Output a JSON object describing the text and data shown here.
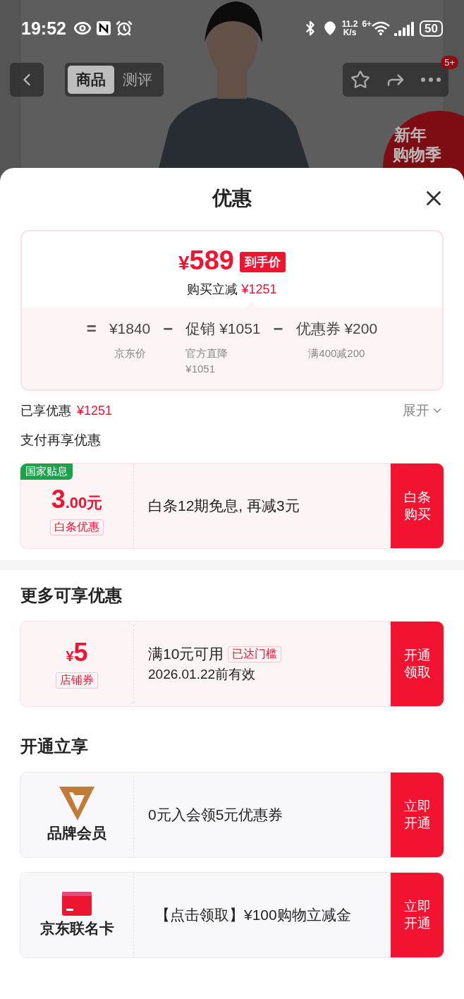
{
  "status_bar": {
    "time": "19:52",
    "speed_value": "11.2",
    "speed_unit": "K/s",
    "network": "6+",
    "battery": "50"
  },
  "nav": {
    "tabs": [
      {
        "label": "商品",
        "selected": true
      },
      {
        "label": "测评",
        "selected": false
      }
    ],
    "more_badge": "5+"
  },
  "promo_badge": [
    "新年",
    "购物季"
  ],
  "sheet": {
    "title": "优惠"
  },
  "price": {
    "currency": "¥",
    "amount": "589",
    "tag": "到手价",
    "saving_label": "购买立减",
    "saving_amount": "¥1251",
    "breakdown": [
      {
        "operator": "=",
        "value": "¥1840",
        "note": "京东价"
      },
      {
        "operator": "−",
        "label": "促销",
        "value": "¥1051",
        "note": "官方直降¥1051"
      },
      {
        "operator": "−",
        "label": "优惠券",
        "value": "¥200",
        "note": "满400减200"
      }
    ]
  },
  "enjoyed": {
    "label": "已享优惠",
    "amount": "¥1251",
    "toggle": "展开",
    "expanded": false
  },
  "payment": {
    "title": "支付再享优惠",
    "coupons": [
      {
        "kind": "amount",
        "notched": false,
        "corner_tag": "国家贴息",
        "amount": "3",
        "amount_suffix": ".00元",
        "label": "白条优惠",
        "text": "白条12期免息, 再减3元",
        "action": "白条购买"
      }
    ]
  },
  "more": {
    "title": "更多可享优惠",
    "coupons": [
      {
        "kind": "amount",
        "notched": true,
        "currency": "¥",
        "amount": "5",
        "label": "店铺券",
        "text": "满10元可用",
        "text_tag": "已达门槛",
        "subtext": "2026.01.22前有效",
        "action": "开通领取"
      }
    ]
  },
  "open": {
    "title": "开通立享",
    "coupons": [
      {
        "kind": "member",
        "label": "品牌会员",
        "text": "0元入会领5元优惠券",
        "action": "立即开通"
      },
      {
        "kind": "card",
        "label": "京东联名卡",
        "text": "【点击领取】¥100购物立减金",
        "action": "立即开通"
      }
    ]
  }
}
